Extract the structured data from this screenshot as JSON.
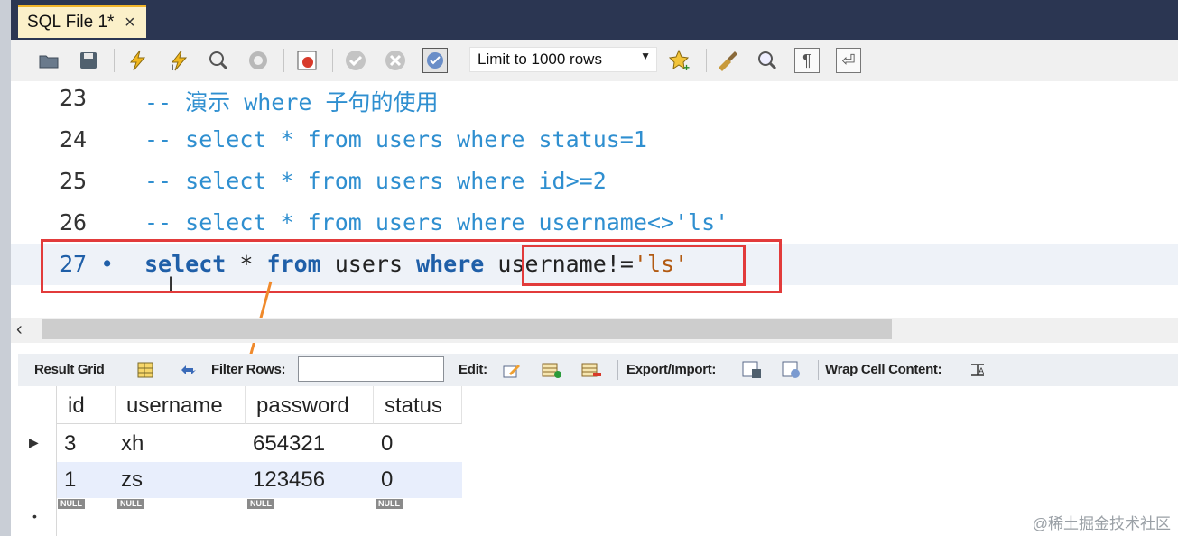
{
  "tab": {
    "title": "SQL File 1*",
    "close": "×"
  },
  "toolbar": {
    "limit_select_value": "Limit to 1000 rows",
    "icons": [
      "open-folder-icon",
      "save-icon",
      "execute-icon",
      "execute-current-icon",
      "explain-icon",
      "stop-icon",
      "toggle-error-icon",
      "commit-icon",
      "rollback-icon",
      "autocommit-icon",
      "bookmark-icon",
      "beautify-icon",
      "find-icon",
      "invisible-chars-icon",
      "wrap-icon"
    ]
  },
  "editor": {
    "lines": [
      {
        "number": "23",
        "text": "-- 演示 where 子句的使用"
      },
      {
        "number": "24",
        "text": "-- select * from users where status=1"
      },
      {
        "number": "25",
        "text": "-- select * from users where id>=2"
      },
      {
        "number": "26",
        "text": "-- select * from users where username<>'ls'"
      },
      {
        "number": "27 •",
        "kw1": "select",
        "star": " * ",
        "kw2": "from",
        "mid": " users ",
        "kw3": "where",
        "cond_col": "username!=",
        "cond_val": "'ls'"
      }
    ]
  },
  "result_toolbar": {
    "result_grid": "Result Grid",
    "filter_rows": "Filter Rows:",
    "filter_value": "",
    "edit": "Edit:",
    "export_import": "Export/Import:",
    "wrap_cell": "Wrap Cell Content:"
  },
  "grid": {
    "columns": [
      "id",
      "username",
      "password",
      "status"
    ],
    "rows": [
      [
        "3",
        "xh",
        "654321",
        "0"
      ],
      [
        "1",
        "zs",
        "123456",
        "0"
      ]
    ],
    "null_label": "NULL"
  },
  "watermark": "@稀土掘金技术社区",
  "colors": {
    "highlight_box": "#e23b3b",
    "arrow": "#f08a2c",
    "comment": "#2f8fd0",
    "keyword": "#1f5fa8"
  }
}
